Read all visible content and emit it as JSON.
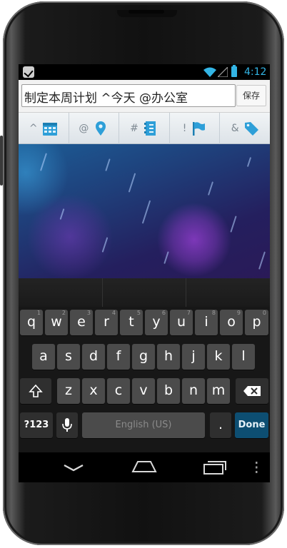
{
  "status_bar": {
    "time": "4:12",
    "notification_icon": "checkmark-icon",
    "wifi_icon": "wifi-icon",
    "signal_icon": "signal-icon",
    "battery_icon": "battery-icon",
    "accent_color": "#33b5e5"
  },
  "task_entry": {
    "value": "制定本周计划 ^今天 @办公室",
    "save_label": "保存"
  },
  "symbol_toolbar": [
    {
      "symbol": "^",
      "icon": "calendar-icon"
    },
    {
      "symbol": "@",
      "icon": "location-pin-icon"
    },
    {
      "symbol": "#",
      "icon": "list-icon"
    },
    {
      "symbol": "!",
      "icon": "flag-icon"
    },
    {
      "symbol": "&",
      "icon": "tag-icon"
    }
  ],
  "keyboard": {
    "row1": [
      {
        "label": "q",
        "hint": "1"
      },
      {
        "label": "w",
        "hint": "2"
      },
      {
        "label": "e",
        "hint": "3"
      },
      {
        "label": "r",
        "hint": "4"
      },
      {
        "label": "t",
        "hint": "5"
      },
      {
        "label": "y",
        "hint": "6"
      },
      {
        "label": "u",
        "hint": "7"
      },
      {
        "label": "i",
        "hint": "8"
      },
      {
        "label": "o",
        "hint": "9"
      },
      {
        "label": "p",
        "hint": "0"
      }
    ],
    "row2": [
      "a",
      "s",
      "d",
      "f",
      "g",
      "h",
      "j",
      "k",
      "l"
    ],
    "row3": [
      "z",
      "x",
      "c",
      "v",
      "b",
      "n",
      "m"
    ],
    "symbols_label": "?123",
    "space_label": "English (US)",
    "period_label": ".",
    "done_label": "Done",
    "done_color": "#0d4e72"
  },
  "navigation": {
    "back_icon": "back-icon",
    "home_icon": "home-icon",
    "recents_icon": "recents-icon",
    "menu_icon": "overflow-menu-icon"
  }
}
